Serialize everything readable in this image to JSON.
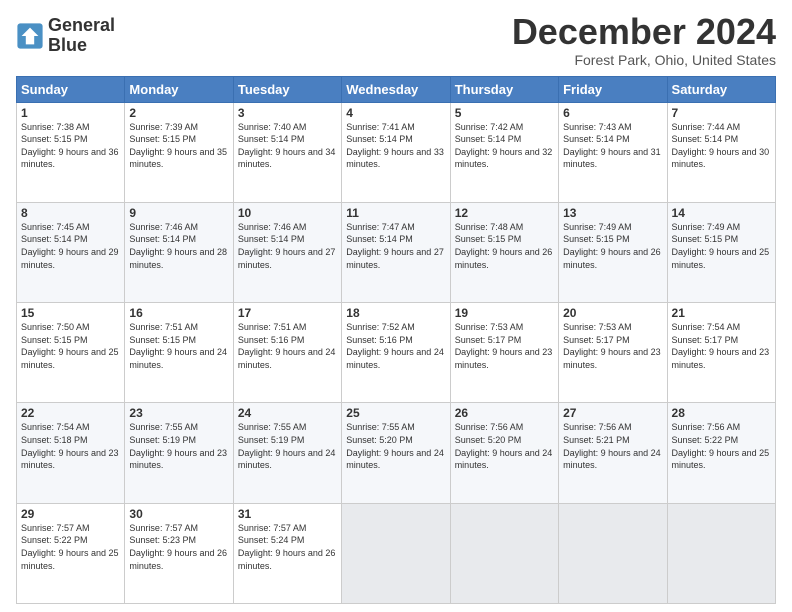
{
  "header": {
    "logo_line1": "General",
    "logo_line2": "Blue",
    "month_year": "December 2024",
    "location": "Forest Park, Ohio, United States"
  },
  "weekdays": [
    "Sunday",
    "Monday",
    "Tuesday",
    "Wednesday",
    "Thursday",
    "Friday",
    "Saturday"
  ],
  "weeks": [
    [
      {
        "day": "1",
        "sunrise": "7:38 AM",
        "sunset": "5:15 PM",
        "daylight": "9 hours and 36 minutes."
      },
      {
        "day": "2",
        "sunrise": "7:39 AM",
        "sunset": "5:15 PM",
        "daylight": "9 hours and 35 minutes."
      },
      {
        "day": "3",
        "sunrise": "7:40 AM",
        "sunset": "5:14 PM",
        "daylight": "9 hours and 34 minutes."
      },
      {
        "day": "4",
        "sunrise": "7:41 AM",
        "sunset": "5:14 PM",
        "daylight": "9 hours and 33 minutes."
      },
      {
        "day": "5",
        "sunrise": "7:42 AM",
        "sunset": "5:14 PM",
        "daylight": "9 hours and 32 minutes."
      },
      {
        "day": "6",
        "sunrise": "7:43 AM",
        "sunset": "5:14 PM",
        "daylight": "9 hours and 31 minutes."
      },
      {
        "day": "7",
        "sunrise": "7:44 AM",
        "sunset": "5:14 PM",
        "daylight": "9 hours and 30 minutes."
      }
    ],
    [
      {
        "day": "8",
        "sunrise": "7:45 AM",
        "sunset": "5:14 PM",
        "daylight": "9 hours and 29 minutes."
      },
      {
        "day": "9",
        "sunrise": "7:46 AM",
        "sunset": "5:14 PM",
        "daylight": "9 hours and 28 minutes."
      },
      {
        "day": "10",
        "sunrise": "7:46 AM",
        "sunset": "5:14 PM",
        "daylight": "9 hours and 27 minutes."
      },
      {
        "day": "11",
        "sunrise": "7:47 AM",
        "sunset": "5:14 PM",
        "daylight": "9 hours and 27 minutes."
      },
      {
        "day": "12",
        "sunrise": "7:48 AM",
        "sunset": "5:15 PM",
        "daylight": "9 hours and 26 minutes."
      },
      {
        "day": "13",
        "sunrise": "7:49 AM",
        "sunset": "5:15 PM",
        "daylight": "9 hours and 26 minutes."
      },
      {
        "day": "14",
        "sunrise": "7:49 AM",
        "sunset": "5:15 PM",
        "daylight": "9 hours and 25 minutes."
      }
    ],
    [
      {
        "day": "15",
        "sunrise": "7:50 AM",
        "sunset": "5:15 PM",
        "daylight": "9 hours and 25 minutes."
      },
      {
        "day": "16",
        "sunrise": "7:51 AM",
        "sunset": "5:15 PM",
        "daylight": "9 hours and 24 minutes."
      },
      {
        "day": "17",
        "sunrise": "7:51 AM",
        "sunset": "5:16 PM",
        "daylight": "9 hours and 24 minutes."
      },
      {
        "day": "18",
        "sunrise": "7:52 AM",
        "sunset": "5:16 PM",
        "daylight": "9 hours and 24 minutes."
      },
      {
        "day": "19",
        "sunrise": "7:53 AM",
        "sunset": "5:17 PM",
        "daylight": "9 hours and 23 minutes."
      },
      {
        "day": "20",
        "sunrise": "7:53 AM",
        "sunset": "5:17 PM",
        "daylight": "9 hours and 23 minutes."
      },
      {
        "day": "21",
        "sunrise": "7:54 AM",
        "sunset": "5:17 PM",
        "daylight": "9 hours and 23 minutes."
      }
    ],
    [
      {
        "day": "22",
        "sunrise": "7:54 AM",
        "sunset": "5:18 PM",
        "daylight": "9 hours and 23 minutes."
      },
      {
        "day": "23",
        "sunrise": "7:55 AM",
        "sunset": "5:19 PM",
        "daylight": "9 hours and 23 minutes."
      },
      {
        "day": "24",
        "sunrise": "7:55 AM",
        "sunset": "5:19 PM",
        "daylight": "9 hours and 24 minutes."
      },
      {
        "day": "25",
        "sunrise": "7:55 AM",
        "sunset": "5:20 PM",
        "daylight": "9 hours and 24 minutes."
      },
      {
        "day": "26",
        "sunrise": "7:56 AM",
        "sunset": "5:20 PM",
        "daylight": "9 hours and 24 minutes."
      },
      {
        "day": "27",
        "sunrise": "7:56 AM",
        "sunset": "5:21 PM",
        "daylight": "9 hours and 24 minutes."
      },
      {
        "day": "28",
        "sunrise": "7:56 AM",
        "sunset": "5:22 PM",
        "daylight": "9 hours and 25 minutes."
      }
    ],
    [
      {
        "day": "29",
        "sunrise": "7:57 AM",
        "sunset": "5:22 PM",
        "daylight": "9 hours and 25 minutes."
      },
      {
        "day": "30",
        "sunrise": "7:57 AM",
        "sunset": "5:23 PM",
        "daylight": "9 hours and 26 minutes."
      },
      {
        "day": "31",
        "sunrise": "7:57 AM",
        "sunset": "5:24 PM",
        "daylight": "9 hours and 26 minutes."
      },
      null,
      null,
      null,
      null
    ]
  ]
}
